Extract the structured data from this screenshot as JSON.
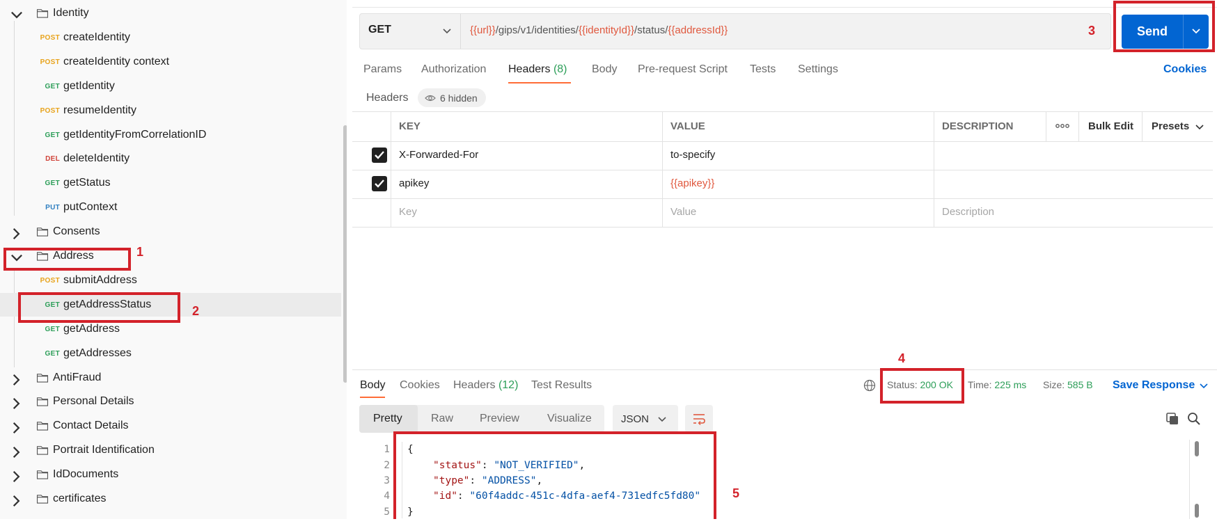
{
  "sidebar": {
    "items": [
      {
        "type": "folder",
        "label": "Identity",
        "expanded": true
      },
      {
        "type": "request",
        "method": "POST",
        "label": "createIdentity"
      },
      {
        "type": "request",
        "method": "POST",
        "label": "createIdentity context"
      },
      {
        "type": "request",
        "method": "GET",
        "label": "getIdentity"
      },
      {
        "type": "request",
        "method": "POST",
        "label": "resumeIdentity"
      },
      {
        "type": "request",
        "method": "GET",
        "label": "getIdentityFromCorrelationID"
      },
      {
        "type": "request",
        "method": "DEL",
        "label": "deleteIdentity"
      },
      {
        "type": "request",
        "method": "GET",
        "label": "getStatus"
      },
      {
        "type": "request",
        "method": "PUT",
        "label": "putContext"
      },
      {
        "type": "folder",
        "label": "Consents",
        "expanded": false
      },
      {
        "type": "folder",
        "label": "Address",
        "expanded": true
      },
      {
        "type": "request",
        "method": "POST",
        "label": "submitAddress"
      },
      {
        "type": "request",
        "method": "GET",
        "label": "getAddressStatus",
        "selected": true
      },
      {
        "type": "request",
        "method": "GET",
        "label": "getAddress"
      },
      {
        "type": "request",
        "method": "GET",
        "label": "getAddresses"
      },
      {
        "type": "folder",
        "label": "AntiFraud",
        "expanded": false
      },
      {
        "type": "folder",
        "label": "Personal Details",
        "expanded": false
      },
      {
        "type": "folder",
        "label": "Contact Details",
        "expanded": false
      },
      {
        "type": "folder",
        "label": "Portrait Identification",
        "expanded": false
      },
      {
        "type": "folder",
        "label": "IdDocuments",
        "expanded": false
      },
      {
        "type": "folder",
        "label": "certificates",
        "expanded": false
      }
    ]
  },
  "annotations": {
    "n1": "1",
    "n2": "2",
    "n3": "3",
    "n4": "4",
    "n5": "5"
  },
  "request": {
    "method": "GET",
    "url_parts": {
      "p1": "{{url}}",
      "p2": "/gips/v1/identities/",
      "p3": "{{identityId}}",
      "p4": "/status/",
      "p5": "{{addressId}}"
    },
    "send_label": "Send",
    "tabs": {
      "params": "Params",
      "authorization": "Authorization",
      "headers": "Headers",
      "headers_count": "(8)",
      "body": "Body",
      "prerequest": "Pre-request Script",
      "tests": "Tests",
      "settings": "Settings"
    },
    "cookies_link": "Cookies",
    "headers_title": "Headers",
    "hidden_badge": "6 hidden",
    "table": {
      "col_key": "KEY",
      "col_value": "VALUE",
      "col_description": "DESCRIPTION",
      "bulk_edit": "Bulk Edit",
      "presets": "Presets",
      "rows": [
        {
          "key": "X-Forwarded-For",
          "value": "to-specify"
        },
        {
          "key": "apikey",
          "value": "{{apikey}}"
        }
      ],
      "placeholder_key": "Key",
      "placeholder_value": "Value",
      "placeholder_description": "Description"
    }
  },
  "response": {
    "tabs": {
      "body": "Body",
      "cookies": "Cookies",
      "headers": "Headers",
      "headers_count": "(12)",
      "test_results": "Test Results"
    },
    "status_label": "Status:",
    "status_value": "200 OK",
    "time_label": "Time:",
    "time_value": "225 ms",
    "size_label": "Size:",
    "size_value": "585 B",
    "save_response": "Save Response",
    "view_modes": {
      "pretty": "Pretty",
      "raw": "Raw",
      "preview": "Preview",
      "visualize": "Visualize"
    },
    "format": "JSON",
    "code": {
      "open": "{",
      "k1": "\"status\"",
      "v1": "\"NOT_VERIFIED\"",
      "k2": "\"type\"",
      "v2": "\"ADDRESS\"",
      "k3": "\"id\"",
      "v3": "\"60f4addc-451c-4dfa-aef4-731edfc5fd80\"",
      "close": "}"
    },
    "line_numbers": [
      "1",
      "2",
      "3",
      "4",
      "5"
    ]
  },
  "colors": {
    "accent": "#0265d2",
    "annotation_red": "#d3222a",
    "status_green": "#2c9e58",
    "variable": "#e0583e"
  }
}
